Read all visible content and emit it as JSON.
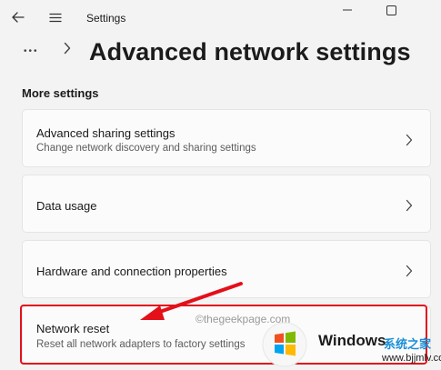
{
  "window": {
    "title": "Settings",
    "controls": {
      "minimize": "minimize",
      "maximize": "maximize"
    }
  },
  "header": {
    "more_glyph": "•••",
    "chevron_glyph": "›",
    "title": "Advanced network settings"
  },
  "section": {
    "label": "More settings"
  },
  "cards": [
    {
      "title": "Advanced sharing settings",
      "description": "Change network discovery and sharing settings"
    },
    {
      "title": "Data usage",
      "description": ""
    },
    {
      "title": "Hardware and connection properties",
      "description": ""
    },
    {
      "title": "Network reset",
      "description": "Reset all network adapters to factory settings"
    }
  ],
  "watermark": {
    "site": "©thegeekpage.com",
    "windows_label": "Windows",
    "cn_label": "系统之家",
    "url": "www.bjjmlv.com"
  },
  "colors": {
    "highlight": "#e3101a",
    "arrow": "#e3101a",
    "background": "#f3f3f3",
    "card": "#fbfbfb"
  },
  "icons": [
    "back-arrow-icon",
    "hamburger-menu-icon",
    "minimize-icon",
    "maximize-icon",
    "more-icon",
    "chevron-right-icon",
    "windows-logo-icon"
  ]
}
